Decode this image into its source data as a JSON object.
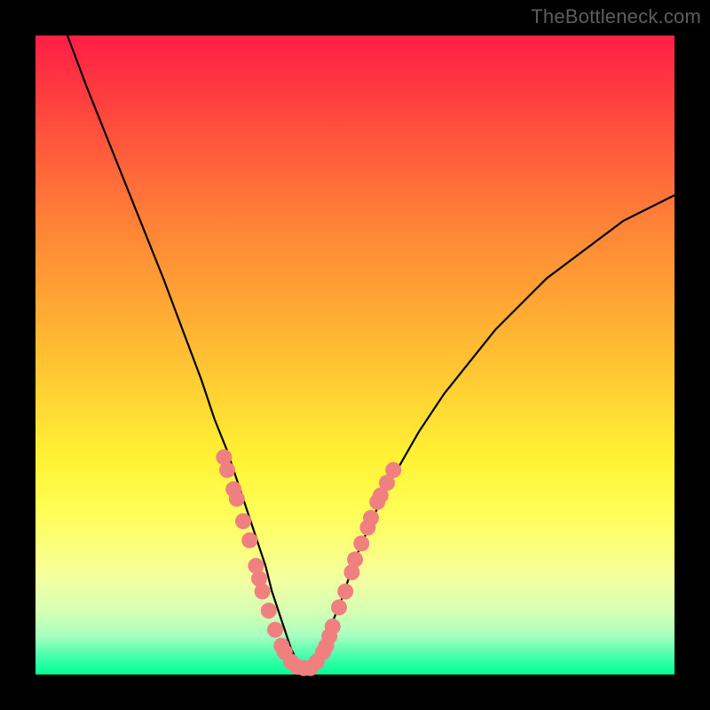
{
  "watermark": "TheBottleneck.com",
  "colors": {
    "curve": "#000000",
    "markers": "#f08080",
    "background_top": "#ff1e46",
    "background_bottom": "#00ff94",
    "frame": "#000000"
  },
  "chart_data": {
    "type": "line",
    "title": "",
    "xlabel": "",
    "ylabel": "",
    "xlim": [
      0,
      100
    ],
    "ylim": [
      0,
      100
    ],
    "grid": false,
    "series": [
      {
        "name": "bottleneck-curve",
        "x": [
          5,
          8,
          12,
          16,
          20,
          23,
          26,
          28,
          30,
          32,
          34,
          35,
          36,
          37,
          38,
          39,
          40,
          41,
          42,
          43,
          44,
          45,
          46,
          48,
          50,
          53,
          56,
          60,
          64,
          68,
          72,
          76,
          80,
          84,
          88,
          92,
          96,
          100
        ],
        "y": [
          100,
          92,
          82,
          72,
          62,
          54,
          46,
          40,
          35,
          29,
          23,
          20,
          17,
          13,
          10,
          7,
          4,
          2,
          1,
          1,
          2,
          4,
          7,
          12,
          18,
          25,
          31,
          38,
          44,
          49,
          54,
          58,
          62,
          65,
          68,
          71,
          73,
          75
        ]
      }
    ],
    "markers": [
      {
        "x": 29.5,
        "y": 34
      },
      {
        "x": 30.0,
        "y": 32
      },
      {
        "x": 31.0,
        "y": 29
      },
      {
        "x": 31.5,
        "y": 27.5
      },
      {
        "x": 32.5,
        "y": 24
      },
      {
        "x": 33.5,
        "y": 21
      },
      {
        "x": 34.5,
        "y": 17
      },
      {
        "x": 35.0,
        "y": 15
      },
      {
        "x": 35.5,
        "y": 13
      },
      {
        "x": 36.5,
        "y": 10
      },
      {
        "x": 37.5,
        "y": 7
      },
      {
        "x": 38.5,
        "y": 4.5
      },
      {
        "x": 39.0,
        "y": 3.5
      },
      {
        "x": 40.0,
        "y": 2
      },
      {
        "x": 41.0,
        "y": 1.2
      },
      {
        "x": 42.0,
        "y": 1
      },
      {
        "x": 43.0,
        "y": 1
      },
      {
        "x": 44.0,
        "y": 2
      },
      {
        "x": 45.0,
        "y": 3.5
      },
      {
        "x": 45.5,
        "y": 4.5
      },
      {
        "x": 46.0,
        "y": 6
      },
      {
        "x": 46.5,
        "y": 7.5
      },
      {
        "x": 47.5,
        "y": 10.5
      },
      {
        "x": 48.5,
        "y": 13
      },
      {
        "x": 49.5,
        "y": 16
      },
      {
        "x": 50.0,
        "y": 18
      },
      {
        "x": 51.0,
        "y": 20.5
      },
      {
        "x": 52.0,
        "y": 23
      },
      {
        "x": 52.5,
        "y": 24.5
      },
      {
        "x": 53.5,
        "y": 27
      },
      {
        "x": 54.0,
        "y": 28
      },
      {
        "x": 55.0,
        "y": 30
      },
      {
        "x": 56.0,
        "y": 32
      }
    ]
  }
}
